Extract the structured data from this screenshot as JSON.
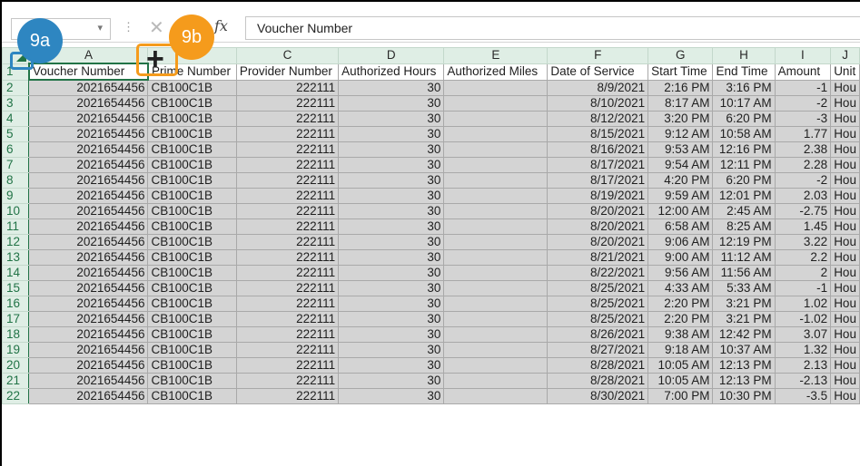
{
  "formula_bar": {
    "namebox_dropdown": "▾",
    "separator": "⋮",
    "cancel_glyph": "✕",
    "enter_glyph": "✓",
    "fx_label": "fx",
    "formula_value": "Voucher Number"
  },
  "callouts": {
    "a_label": "9a",
    "b_label": "9b",
    "a_color": "#2e86c1",
    "b_color": "#f59b1c",
    "cursor_icon": "plus-cursor-icon",
    "cursor_glyph": "+"
  },
  "columns": [
    "A",
    "B",
    "C",
    "D",
    "E",
    "F",
    "G",
    "H",
    "I",
    "J"
  ],
  "headers": [
    "Voucher Number",
    "Prime Number",
    "Provider Number",
    "Authorized Hours",
    "Authorized Miles",
    "Date of Service",
    "Start Time",
    "End Time",
    "Amount",
    "Unit"
  ],
  "rows": [
    {
      "n": "2",
      "v": "2021654456",
      "p": "CB100C1B",
      "pr": "222111",
      "h": "30",
      "m": "",
      "d": "8/9/2021",
      "s": "2:16 PM",
      "e": "3:16 PM",
      "a": "-1",
      "u": "Hou"
    },
    {
      "n": "3",
      "v": "2021654456",
      "p": "CB100C1B",
      "pr": "222111",
      "h": "30",
      "m": "",
      "d": "8/10/2021",
      "s": "8:17 AM",
      "e": "10:17 AM",
      "a": "-2",
      "u": "Hou"
    },
    {
      "n": "4",
      "v": "2021654456",
      "p": "CB100C1B",
      "pr": "222111",
      "h": "30",
      "m": "",
      "d": "8/12/2021",
      "s": "3:20 PM",
      "e": "6:20 PM",
      "a": "-3",
      "u": "Hou"
    },
    {
      "n": "5",
      "v": "2021654456",
      "p": "CB100C1B",
      "pr": "222111",
      "h": "30",
      "m": "",
      "d": "8/15/2021",
      "s": "9:12 AM",
      "e": "10:58 AM",
      "a": "1.77",
      "u": "Hou"
    },
    {
      "n": "6",
      "v": "2021654456",
      "p": "CB100C1B",
      "pr": "222111",
      "h": "30",
      "m": "",
      "d": "8/16/2021",
      "s": "9:53 AM",
      "e": "12:16 PM",
      "a": "2.38",
      "u": "Hou"
    },
    {
      "n": "7",
      "v": "2021654456",
      "p": "CB100C1B",
      "pr": "222111",
      "h": "30",
      "m": "",
      "d": "8/17/2021",
      "s": "9:54 AM",
      "e": "12:11 PM",
      "a": "2.28",
      "u": "Hou"
    },
    {
      "n": "8",
      "v": "2021654456",
      "p": "CB100C1B",
      "pr": "222111",
      "h": "30",
      "m": "",
      "d": "8/17/2021",
      "s": "4:20 PM",
      "e": "6:20 PM",
      "a": "-2",
      "u": "Hou"
    },
    {
      "n": "9",
      "v": "2021654456",
      "p": "CB100C1B",
      "pr": "222111",
      "h": "30",
      "m": "",
      "d": "8/19/2021",
      "s": "9:59 AM",
      "e": "12:01 PM",
      "a": "2.03",
      "u": "Hou"
    },
    {
      "n": "10",
      "v": "2021654456",
      "p": "CB100C1B",
      "pr": "222111",
      "h": "30",
      "m": "",
      "d": "8/20/2021",
      "s": "12:00 AM",
      "e": "2:45 AM",
      "a": "-2.75",
      "u": "Hou"
    },
    {
      "n": "11",
      "v": "2021654456",
      "p": "CB100C1B",
      "pr": "222111",
      "h": "30",
      "m": "",
      "d": "8/20/2021",
      "s": "6:58 AM",
      "e": "8:25 AM",
      "a": "1.45",
      "u": "Hou"
    },
    {
      "n": "12",
      "v": "2021654456",
      "p": "CB100C1B",
      "pr": "222111",
      "h": "30",
      "m": "",
      "d": "8/20/2021",
      "s": "9:06 AM",
      "e": "12:19 PM",
      "a": "3.22",
      "u": "Hou"
    },
    {
      "n": "13",
      "v": "2021654456",
      "p": "CB100C1B",
      "pr": "222111",
      "h": "30",
      "m": "",
      "d": "8/21/2021",
      "s": "9:00 AM",
      "e": "11:12 AM",
      "a": "2.2",
      "u": "Hou"
    },
    {
      "n": "14",
      "v": "2021654456",
      "p": "CB100C1B",
      "pr": "222111",
      "h": "30",
      "m": "",
      "d": "8/22/2021",
      "s": "9:56 AM",
      "e": "11:56 AM",
      "a": "2",
      "u": "Hou"
    },
    {
      "n": "15",
      "v": "2021654456",
      "p": "CB100C1B",
      "pr": "222111",
      "h": "30",
      "m": "",
      "d": "8/25/2021",
      "s": "4:33 AM",
      "e": "5:33 AM",
      "a": "-1",
      "u": "Hou"
    },
    {
      "n": "16",
      "v": "2021654456",
      "p": "CB100C1B",
      "pr": "222111",
      "h": "30",
      "m": "",
      "d": "8/25/2021",
      "s": "2:20 PM",
      "e": "3:21 PM",
      "a": "1.02",
      "u": "Hou"
    },
    {
      "n": "17",
      "v": "2021654456",
      "p": "CB100C1B",
      "pr": "222111",
      "h": "30",
      "m": "",
      "d": "8/25/2021",
      "s": "2:20 PM",
      "e": "3:21 PM",
      "a": "-1.02",
      "u": "Hou"
    },
    {
      "n": "18",
      "v": "2021654456",
      "p": "CB100C1B",
      "pr": "222111",
      "h": "30",
      "m": "",
      "d": "8/26/2021",
      "s": "9:38 AM",
      "e": "12:42 PM",
      "a": "3.07",
      "u": "Hou"
    },
    {
      "n": "19",
      "v": "2021654456",
      "p": "CB100C1B",
      "pr": "222111",
      "h": "30",
      "m": "",
      "d": "8/27/2021",
      "s": "9:18 AM",
      "e": "10:37 AM",
      "a": "1.32",
      "u": "Hou"
    },
    {
      "n": "20",
      "v": "2021654456",
      "p": "CB100C1B",
      "pr": "222111",
      "h": "30",
      "m": "",
      "d": "8/28/2021",
      "s": "10:05 AM",
      "e": "12:13 PM",
      "a": "2.13",
      "u": "Hou"
    },
    {
      "n": "21",
      "v": "2021654456",
      "p": "CB100C1B",
      "pr": "222111",
      "h": "30",
      "m": "",
      "d": "8/28/2021",
      "s": "10:05 AM",
      "e": "12:13 PM",
      "a": "-2.13",
      "u": "Hou"
    },
    {
      "n": "22",
      "v": "2021654456",
      "p": "CB100C1B",
      "pr": "222111",
      "h": "30",
      "m": "",
      "d": "8/30/2021",
      "s": "7:00 PM",
      "e": "10:30 PM",
      "a": "-3.5",
      "u": "Hou"
    }
  ]
}
